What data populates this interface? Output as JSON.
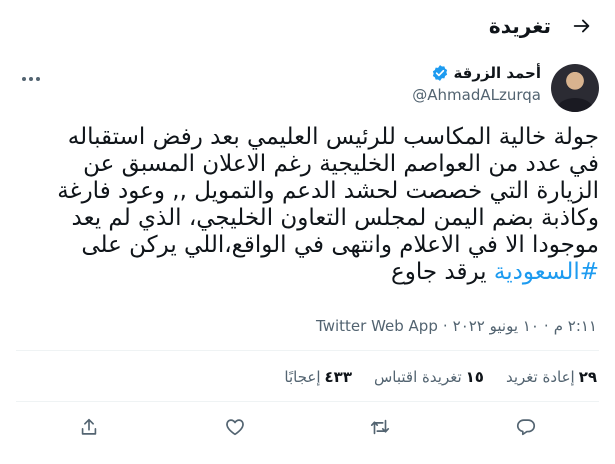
{
  "header": {
    "title": "تغريدة"
  },
  "author": {
    "name": "أحمد الزرقة",
    "handle": "@AhmadALzurqa"
  },
  "tweet": {
    "lines": [
      "جولة خالية المكاسب للرئيس العليمي بعد رفض استقباله",
      "في عدد من العواصم الخليجية رغم الاعلان المسبق عن",
      "الزيارة التي خصصت لحشد الدعم والتمويل ,, وعود فارغة",
      "وكاذبة بضم اليمن لمجلس التعاون الخليجي، الذي لم يعد",
      "موجودا الا في الاعلام وانتهى في الواقع،اللي يركن على"
    ],
    "hashtag": "#السعودية",
    "last_line_rest": " يرقد جاوع"
  },
  "meta": {
    "time": "٢:١١ م",
    "date": "١٠ يونيو ٢٠٢٢",
    "separator": "·",
    "source": "Twitter Web App"
  },
  "stats": {
    "retweets_count": "٢٩",
    "retweets_label": "إعادة تغريد",
    "quotes_count": "١٥",
    "quotes_label": "تغريدة اقتباس",
    "likes_count": "٤٣٣",
    "likes_label": "إعجابًا"
  },
  "icons": {
    "back": "arrow-right-icon",
    "verified": "verified-badge-icon",
    "more": "more-dots-icon",
    "share": "share-icon",
    "like": "heart-icon",
    "retweet": "retweet-icon",
    "reply": "reply-icon"
  },
  "colors": {
    "accent": "#1d9bf0",
    "text": "#0f1419",
    "muted": "#536471"
  }
}
